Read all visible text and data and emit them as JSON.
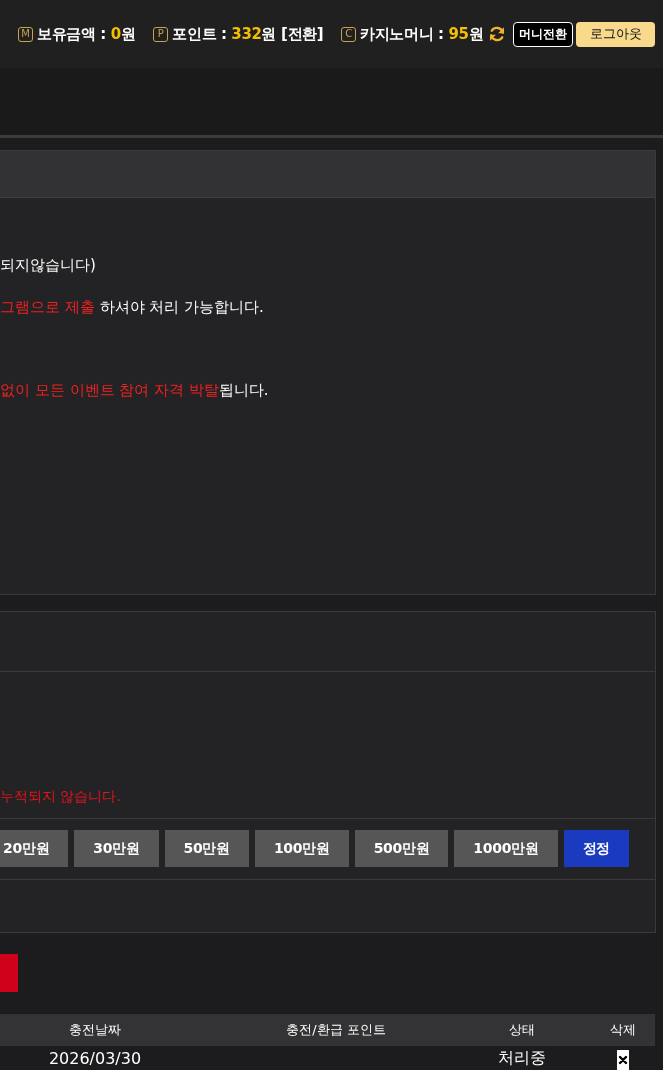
{
  "top_bar": {
    "stats": [
      {
        "badge": "M",
        "label": "보유금액 :",
        "value": "0",
        "unit": "원"
      },
      {
        "badge": "P",
        "label": "포인트 :",
        "value": "332",
        "unit": "원",
        "link": "[전환]"
      },
      {
        "badge": "C",
        "label": "카지노머니 :",
        "value": "95",
        "unit": "원"
      }
    ],
    "convert_button": "머니전환",
    "logout_button": "로그아웃"
  },
  "notice": {
    "lines": [
      [
        {
          "kind": "plain",
          "text": "되지않습니다)"
        }
      ],
      [
        {
          "kind": "alert",
          "text": "그램으로 제출"
        },
        {
          "kind": "plain",
          "text": " 하셔야 처리 가능합니다."
        }
      ],
      [
        {
          "kind": "alert",
          "text": "없이 모든 이벤트 참여 자격 박탈"
        },
        {
          "kind": "plain",
          "text": "됩니다."
        }
      ]
    ]
  },
  "charge": {
    "note": "누적되지 않습니다.",
    "amount_buttons": [
      {
        "kind": "amount",
        "label": "20만원"
      },
      {
        "kind": "amount",
        "label": "30만원"
      },
      {
        "kind": "amount",
        "label": "50만원"
      },
      {
        "kind": "amount",
        "label": "100만원"
      },
      {
        "kind": "amount",
        "label": "500만원"
      },
      {
        "kind": "amount",
        "label": "1000만원"
      },
      {
        "kind": "reset",
        "label": "정정"
      }
    ]
  },
  "history": {
    "columns": [
      "충전날짜",
      "충전/환급 포인트",
      "상태",
      "삭제"
    ],
    "rows": [
      {
        "date": "2026/03/30",
        "status": "처리중"
      }
    ]
  }
}
